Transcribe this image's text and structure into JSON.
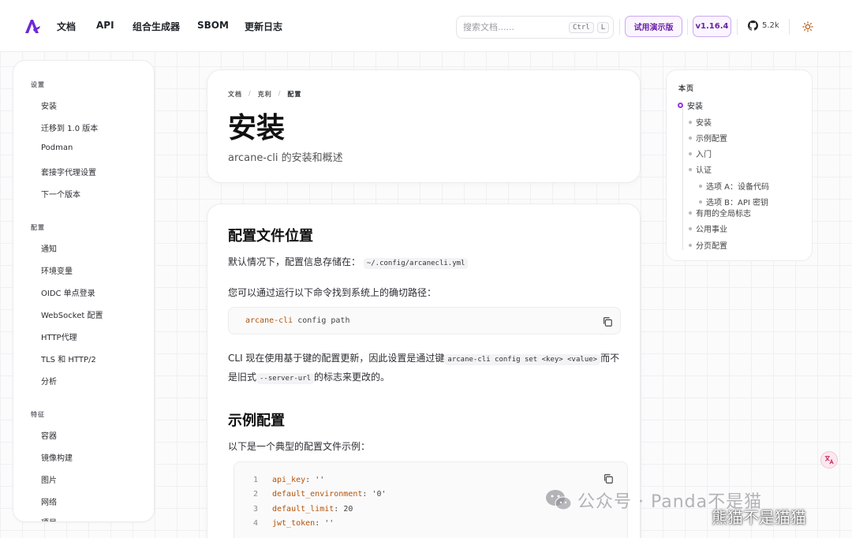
{
  "nav": {
    "items": [
      "文档",
      "API",
      "组合生成器",
      "SBOM",
      "更新日志"
    ],
    "search_placeholder": "搜索文档......",
    "kbd_ctrl": "Ctrl",
    "kbd_l": "L",
    "demo_label": "试用演示版",
    "version_label": "v1.16.4",
    "github_stars": "5.2k"
  },
  "sidebar": {
    "sections": [
      {
        "title": "设置",
        "items": [
          "安装",
          "迁移到 1.0 版本",
          "Podman",
          "套接字代理设置",
          "下一个版本"
        ]
      },
      {
        "title": "配置",
        "items": [
          "通知",
          "环境变量",
          "OIDC 单点登录",
          "WebSocket 配置",
          "HTTP代理",
          "TLS 和 HTTP/2",
          "分析"
        ]
      },
      {
        "title": "特征",
        "items": [
          "容器",
          "镜像构建",
          "图片",
          "网络",
          "项目"
        ]
      }
    ]
  },
  "hero": {
    "breadcrumb": [
      "文档",
      "克利",
      "配置"
    ],
    "title": "安装",
    "subtitle": "arcane-cli 的安装和概述"
  },
  "content": {
    "h_config_location": "配置文件位置",
    "default_text": "默认情况下，配置信息存储在：",
    "default_path": "~/.config/arcanecli.yml",
    "find_path_text": "您可以通过运行以下命令找到系统上的确切路径：",
    "cmd_name": "arcane-cli",
    "cmd_args": "config path",
    "cli_text_1": "CLI 现在使用基于键的配置更新，因此设置是通过键",
    "cli_code_1": "arcane-cli config set <key> <value>",
    "cli_text_2": "而不",
    "cli_text_3": "是旧式",
    "cli_code_2": "--server-url",
    "cli_text_4": "的标志来更改的。",
    "h_example": "示例配置",
    "example_text": "以下是一个典型的配置文件示例：",
    "code_lines": [
      {
        "n": "1",
        "key": "api_key",
        "val": "''"
      },
      {
        "n": "2",
        "key": "default_environment",
        "val": "'0'"
      },
      {
        "n": "3",
        "key": "default_limit",
        "val": "20"
      },
      {
        "n": "4",
        "key": "jwt_token",
        "val": "''"
      }
    ]
  },
  "toc": {
    "title": "本页",
    "items": [
      {
        "label": "安装",
        "level": 0,
        "active": true
      },
      {
        "label": "安装",
        "level": 1
      },
      {
        "label": "示例配置",
        "level": 1
      },
      {
        "label": "入门",
        "level": 1
      },
      {
        "label": "认证",
        "level": 1
      },
      {
        "label": "选项 A：设备代码",
        "level": 2
      },
      {
        "label": "选项 B：API 密钥",
        "level": 2
      },
      {
        "label": "有用的全局标志",
        "level": 1
      },
      {
        "label": "公用事业",
        "level": 1
      },
      {
        "label": "分页配置",
        "level": 1
      }
    ]
  },
  "watermark": {
    "text": "公众号 · Panda不是猫",
    "text2": "熊猫不是猫猫"
  },
  "colors": {
    "accent": "#9333ea",
    "accent_text": "#6b21a8",
    "code_key": "#b45309"
  }
}
